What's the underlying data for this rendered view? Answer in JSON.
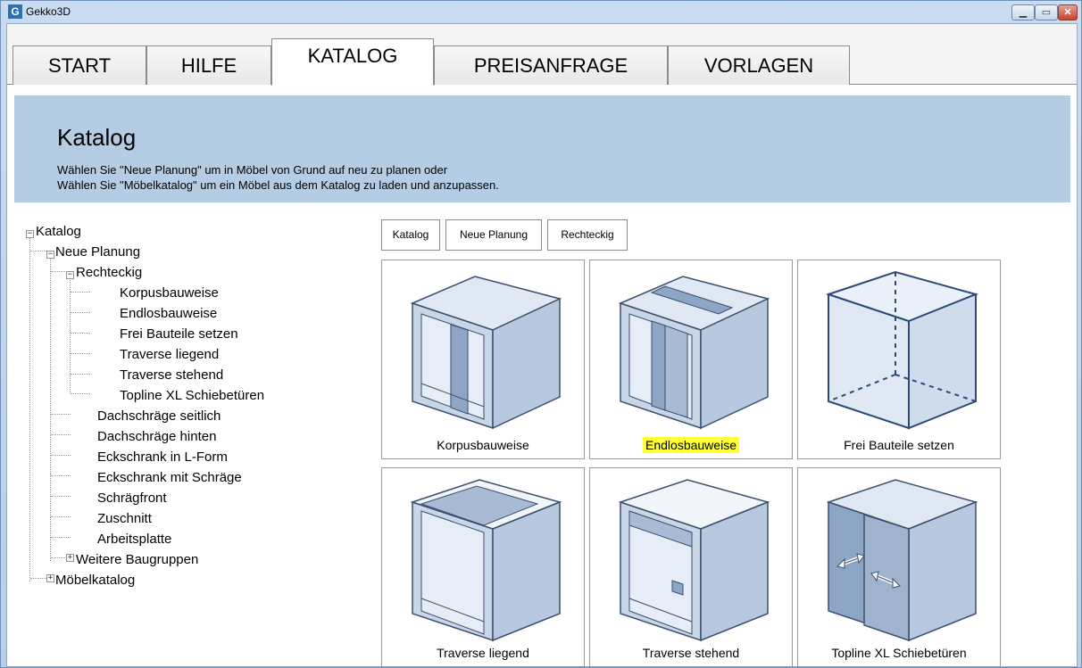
{
  "window": {
    "title": "Gekko3D",
    "logo_letter": "G"
  },
  "tabs": [
    {
      "label": "START"
    },
    {
      "label": "HILFE"
    },
    {
      "label": "KATALOG",
      "active": true
    },
    {
      "label": "PREISANFRAGE"
    },
    {
      "label": "VORLAGEN"
    }
  ],
  "banner": {
    "title": "Katalog",
    "line1": "Wählen Sie \"Neue Planung\" um in Möbel von Grund auf neu zu planen oder",
    "line2": "Wählen Sie \"Möbelkatalog\" um ein Möbel aus dem Katalog zu laden und anzupassen."
  },
  "tree": {
    "root": "Katalog",
    "neue_planung": "Neue Planung",
    "rechteckig": "Rechteckig",
    "rechteckig_children": [
      "Korpusbauweise",
      "Endlosbauweise",
      "Frei Bauteile setzen",
      "Traverse liegend",
      "Traverse stehend",
      "Topline XL Schiebetüren"
    ],
    "planung_children": [
      "Dachschräge seitlich",
      "Dachschräge hinten",
      "Eckschrank in L-Form",
      "Eckschrank mit Schräge",
      "Schrägfront",
      "Zuschnitt",
      "Arbeitsplatte"
    ],
    "weitere": "Weitere Baugruppen",
    "moebelkatalog": "Möbelkatalog"
  },
  "breadcrumb": [
    "Katalog",
    "Neue Planung",
    "Rechteckig"
  ],
  "cards": [
    {
      "label": "Korpusbauweise",
      "highlighted": false
    },
    {
      "label": "Endlosbauweise",
      "highlighted": true
    },
    {
      "label": "Frei Bauteile setzen",
      "highlighted": false
    },
    {
      "label": "Traverse liegend",
      "highlighted": false
    },
    {
      "label": "Traverse stehend",
      "highlighted": false
    },
    {
      "label": "Topline XL Schiebetüren",
      "highlighted": false
    }
  ],
  "colors": {
    "banner": "#b4cce4",
    "highlight": "#ffff33",
    "cabinet_face": "#c9d6e8",
    "cabinet_edge": "#3b4f6e"
  }
}
